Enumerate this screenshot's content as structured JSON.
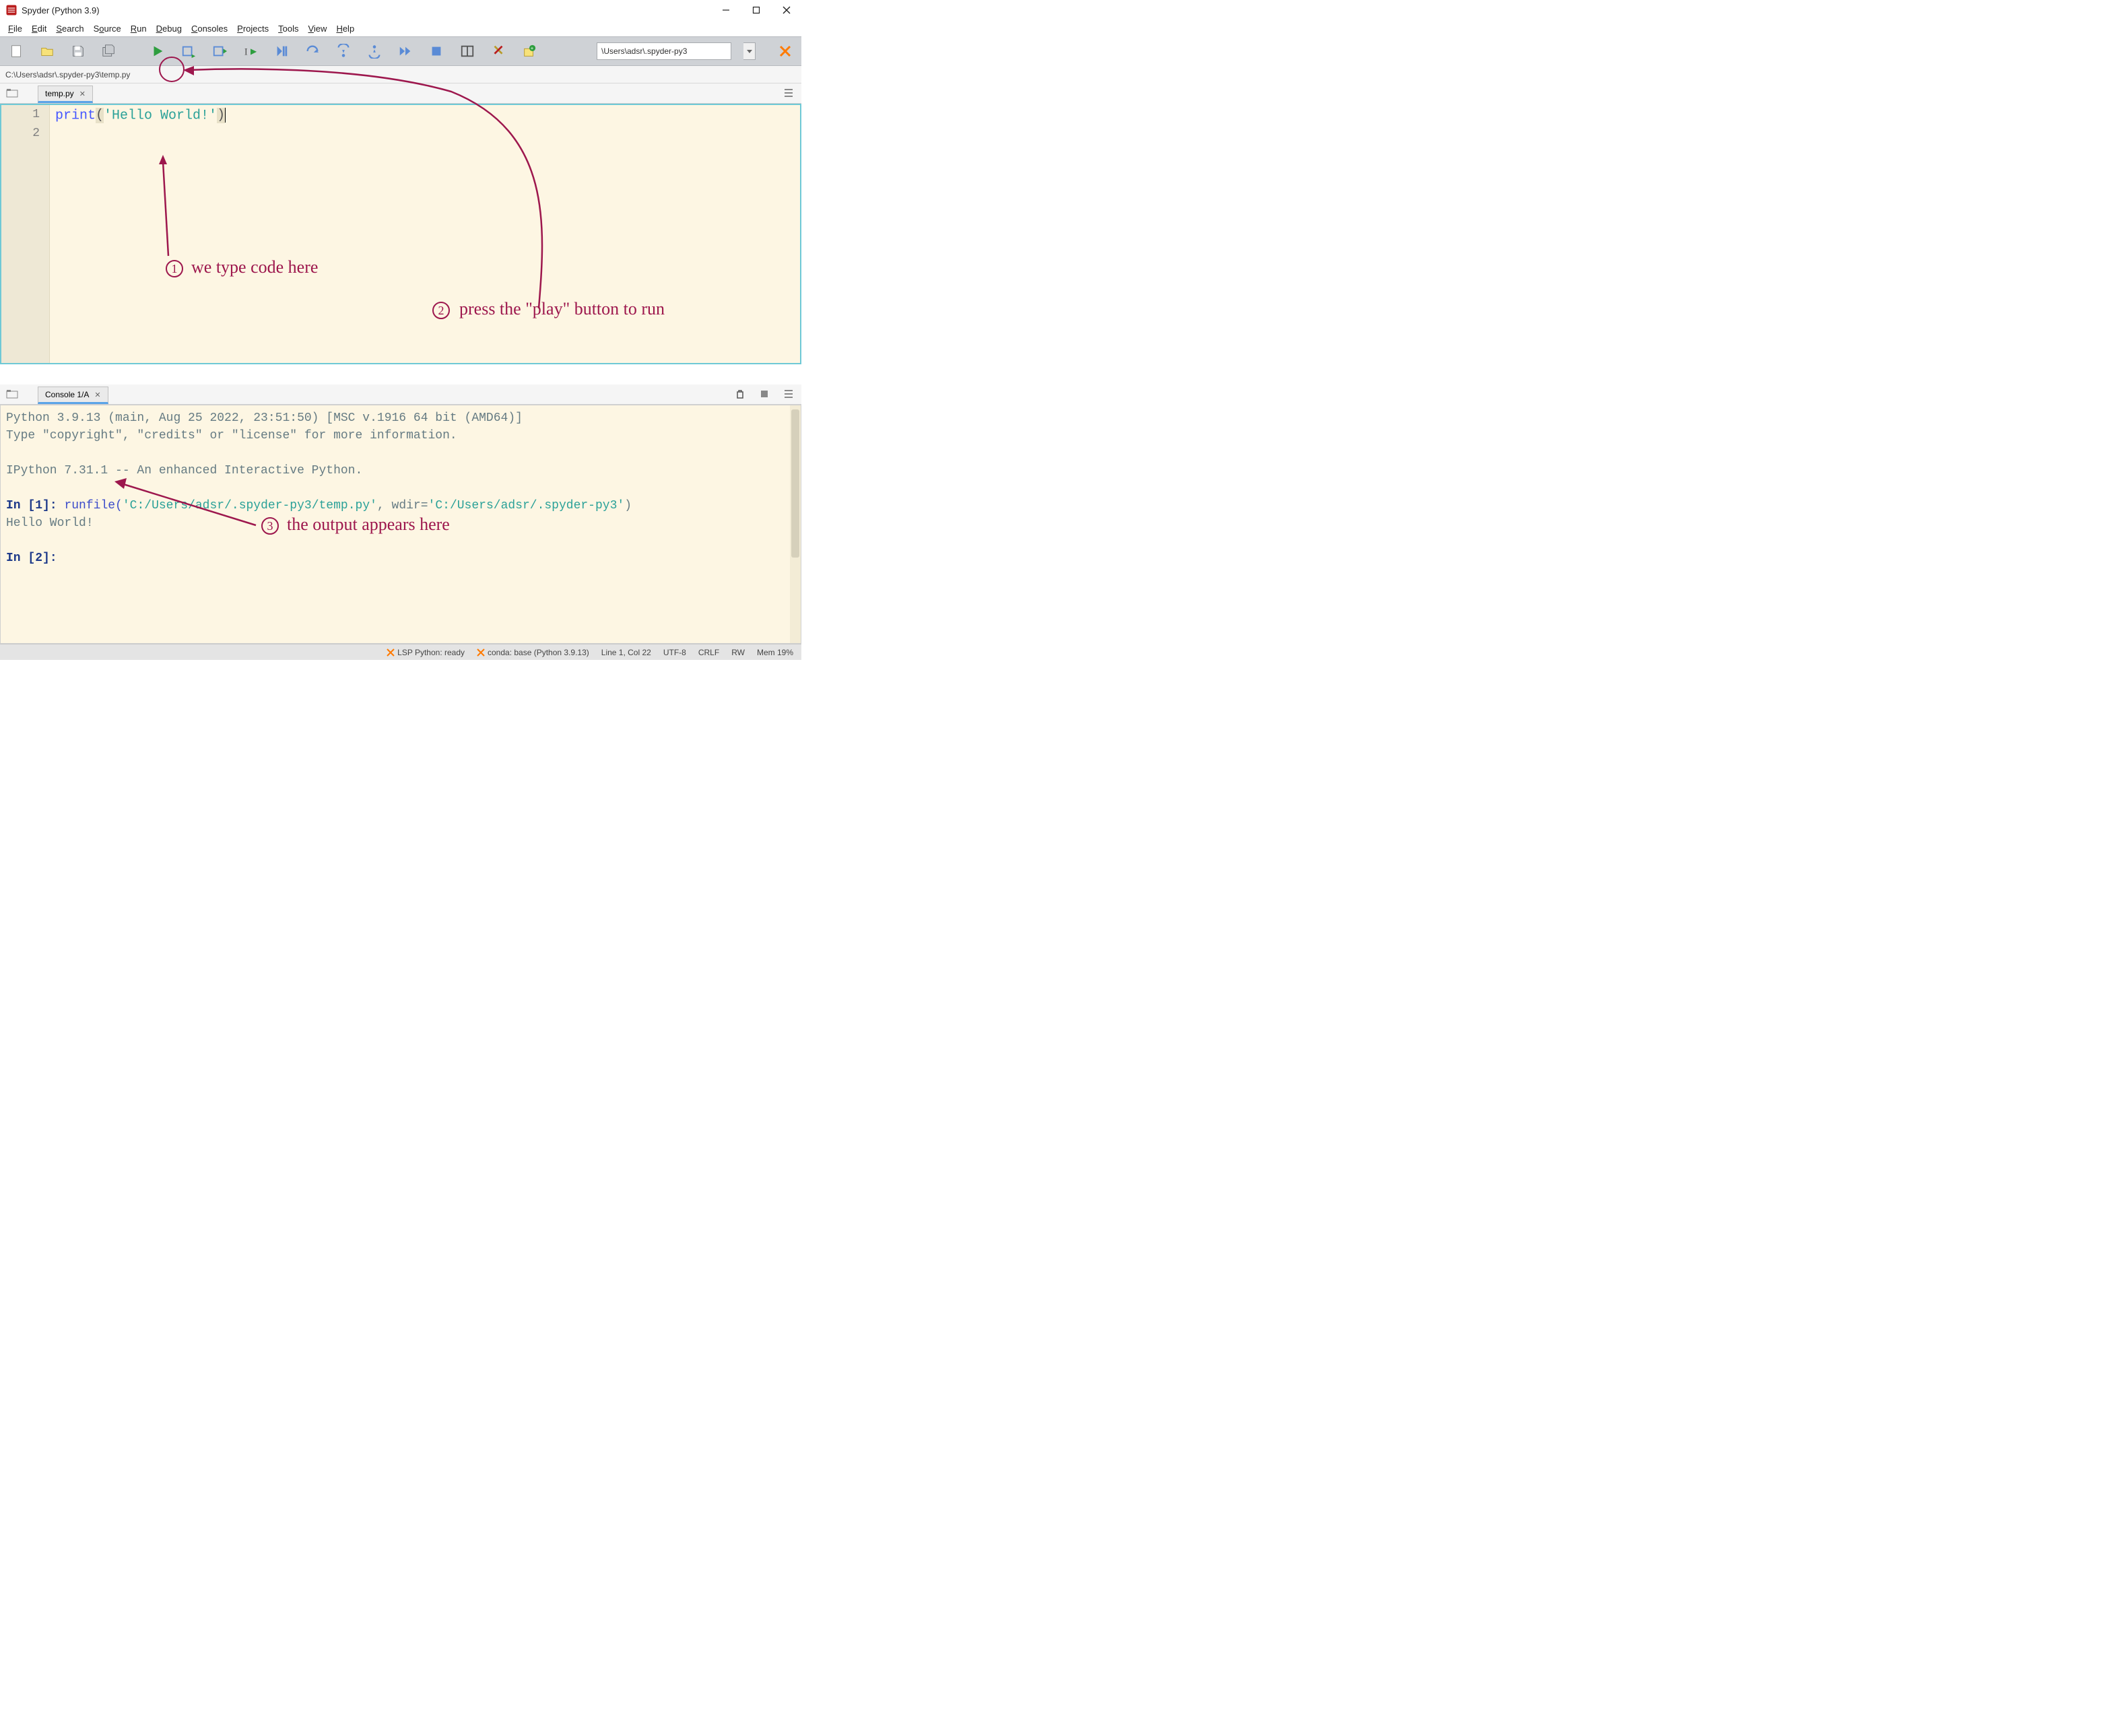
{
  "titlebar": {
    "title": "Spyder (Python 3.9)"
  },
  "menubar": {
    "items": [
      "File",
      "Edit",
      "Search",
      "Source",
      "Run",
      "Debug",
      "Consoles",
      "Projects",
      "Tools",
      "View",
      "Help"
    ]
  },
  "toolbar": {
    "cwd": "\\Users\\adsr\\.spyder-py3"
  },
  "pathbar": {
    "path": "C:\\Users\\adsr\\.spyder-py3\\temp.py"
  },
  "editor": {
    "tab_name": "temp.py",
    "line_numbers": [
      "1",
      "2"
    ],
    "code": {
      "func": "print",
      "lparen": "(",
      "string": "'Hello World!'",
      "rparen": ")"
    }
  },
  "console": {
    "tab_name": "Console 1/A",
    "banner1": "Python 3.9.13 (main, Aug 25 2022, 23:51:50) [MSC v.1916 64 bit (AMD64)]",
    "banner2": "Type \"copyright\", \"credits\" or \"license\" for more information.",
    "ipython": "IPython 7.31.1 -- An enhanced Interactive Python.",
    "in1_prefix": "In [",
    "in1_num": "1",
    "in1_suffix": "]: ",
    "runfile_func": "runfile(",
    "runfile_arg1": "'C:/Users/adsr/.spyder-py3/temp.py'",
    "runfile_mid": ", wdir=",
    "runfile_arg2": "'C:/Users/adsr/.spyder-py3'",
    "runfile_close": ")",
    "output": "Hello World!",
    "in2_prefix": "In [",
    "in2_num": "2",
    "in2_suffix": "]: "
  },
  "statusbar": {
    "lsp": "LSP Python: ready",
    "conda": "conda: base (Python 3.9.13)",
    "cursor": "Line 1, Col 22",
    "encoding": "UTF-8",
    "eol": "CRLF",
    "rw": "RW",
    "mem": "Mem 19%"
  },
  "annotations": {
    "a1": "we type code here",
    "a2": "press the \"play\" button to run",
    "a3": "the output appears here"
  }
}
